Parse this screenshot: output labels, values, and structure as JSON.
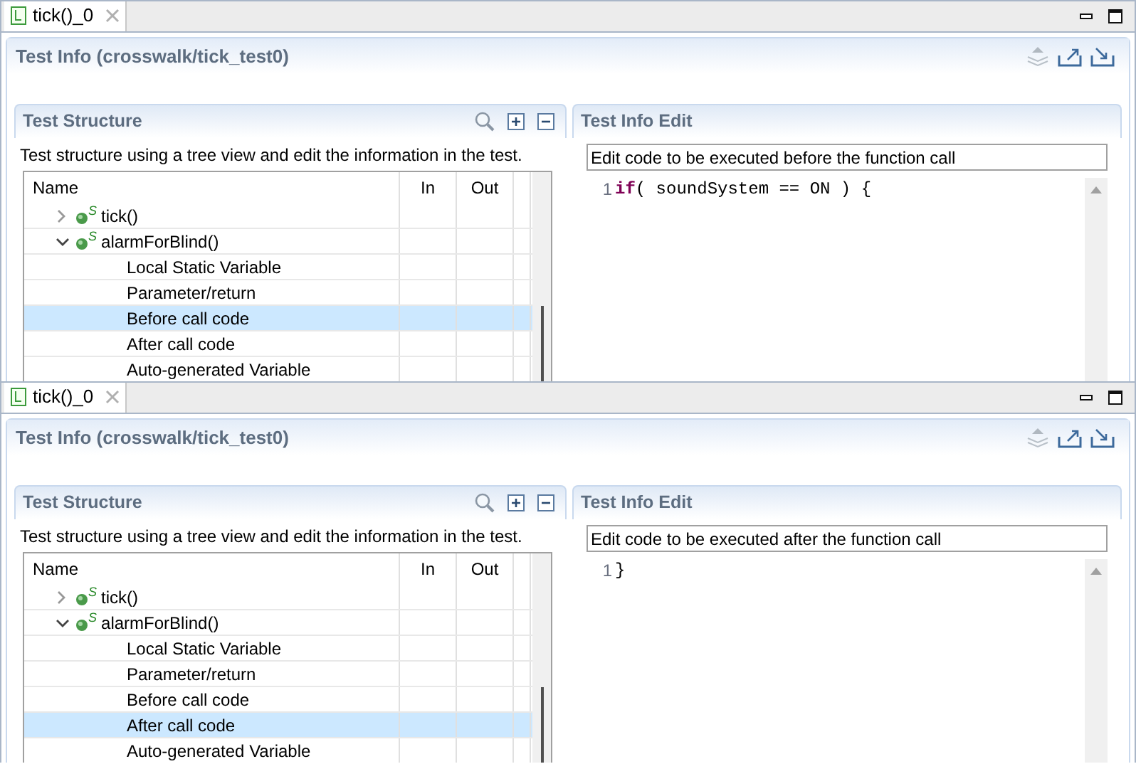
{
  "panes": [
    {
      "tab": {
        "label": "tick()_0",
        "selected": true
      },
      "title": "Test Info (crosswalk/tick_test0)",
      "structure": {
        "title": "Test Structure",
        "description": "Test structure using a tree view and edit the information in the test.",
        "columns": [
          "Name",
          "In",
          "Out"
        ],
        "tree": [
          {
            "label": "tick()",
            "badge": "S",
            "expanded": false,
            "selected": false
          },
          {
            "label": "alarmForBlind()",
            "badge": "S",
            "expanded": true,
            "selected": false,
            "children": [
              {
                "label": "Local Static Variable",
                "selected": false
              },
              {
                "label": "Parameter/return",
                "selected": false
              },
              {
                "label": "Before call code",
                "selected": true
              },
              {
                "label": "After call code",
                "selected": false
              },
              {
                "label": "Auto-generated Variable",
                "selected": false
              }
            ]
          }
        ]
      },
      "edit": {
        "title": "Test Info Edit",
        "field_value": "Edit code to be executed before the function call",
        "code": [
          {
            "number": "1",
            "tokens": [
              {
                "kind": "keyword",
                "text": "if"
              },
              {
                "kind": "plain",
                "text": "( soundSystem == ON ) {"
              }
            ]
          }
        ]
      }
    },
    {
      "tab": {
        "label": "tick()_0",
        "selected": true
      },
      "title": "Test Info (crosswalk/tick_test0)",
      "structure": {
        "title": "Test Structure",
        "description": "Test structure using a tree view and edit the information in the test.",
        "columns": [
          "Name",
          "In",
          "Out"
        ],
        "tree": [
          {
            "label": "tick()",
            "badge": "S",
            "expanded": false,
            "selected": false
          },
          {
            "label": "alarmForBlind()",
            "badge": "S",
            "expanded": true,
            "selected": false,
            "children": [
              {
                "label": "Local Static Variable",
                "selected": false
              },
              {
                "label": "Parameter/return",
                "selected": false
              },
              {
                "label": "Before call code",
                "selected": false
              },
              {
                "label": "After call code",
                "selected": true
              },
              {
                "label": "Auto-generated Variable",
                "selected": false
              }
            ]
          }
        ]
      },
      "edit": {
        "title": "Test Info Edit",
        "field_value": "Edit code to be executed after the function call",
        "code": [
          {
            "number": "1",
            "tokens": [
              {
                "kind": "plain",
                "text": "}"
              }
            ]
          }
        ]
      }
    }
  ]
}
